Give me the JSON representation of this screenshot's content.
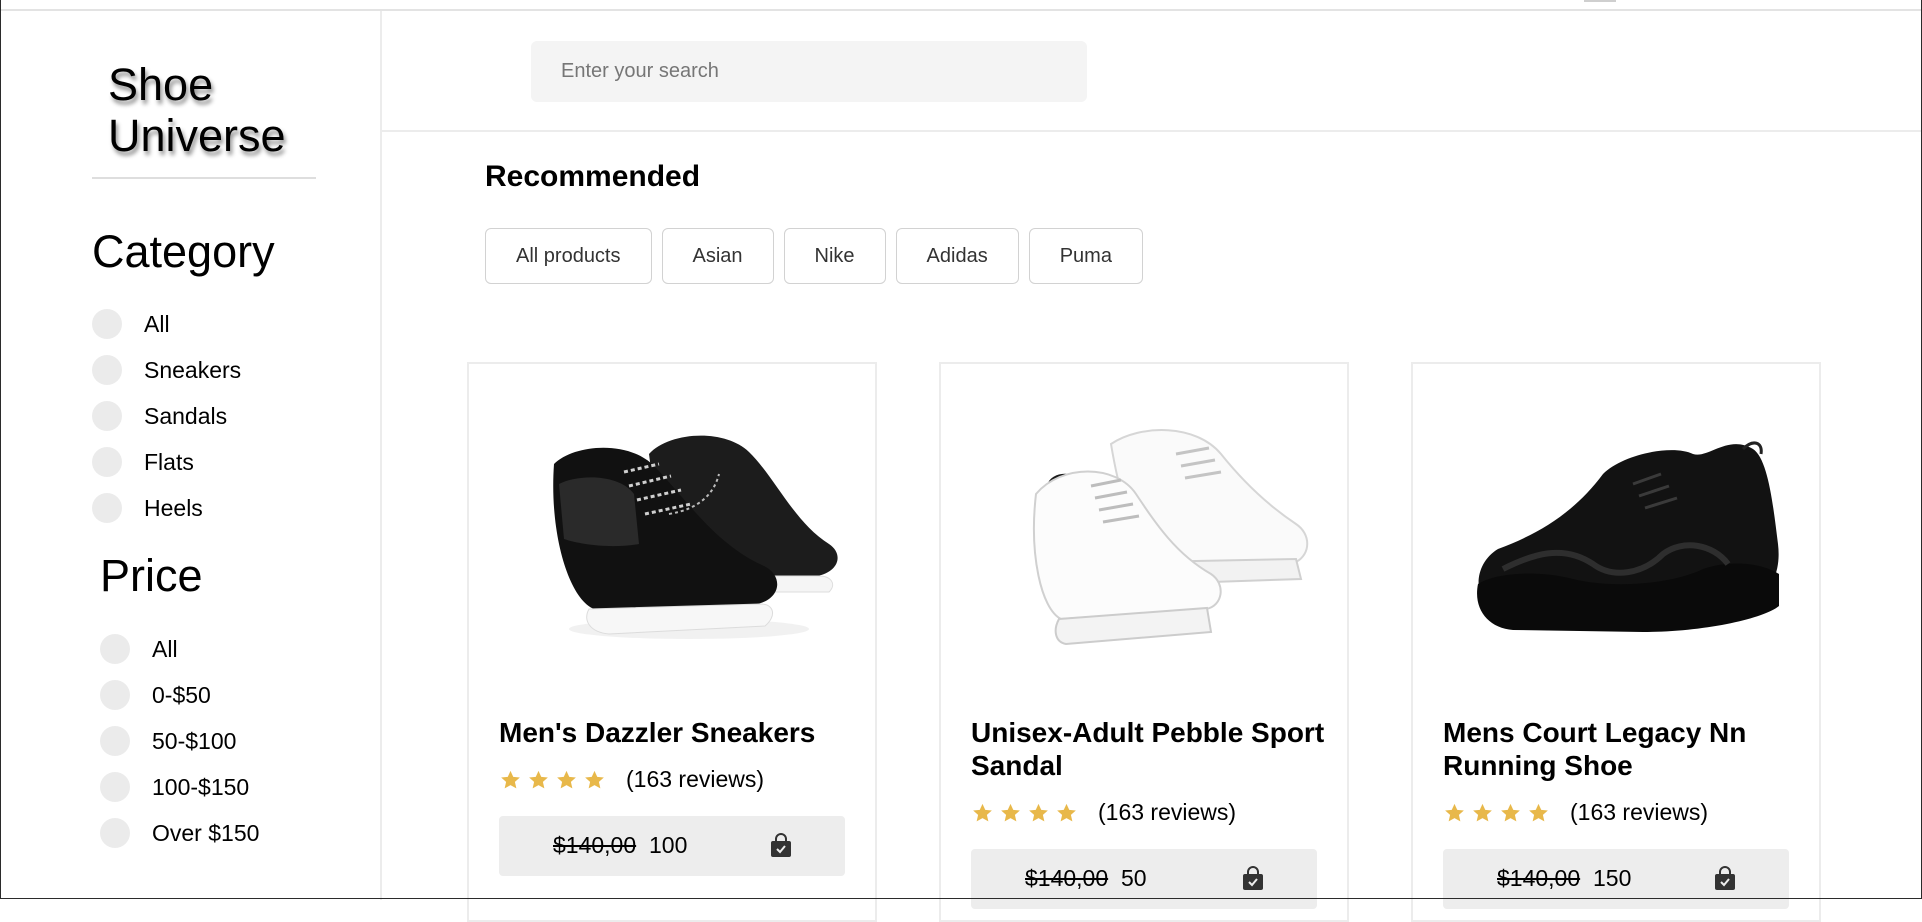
{
  "sidebar": {
    "logo": "Shoe Universe",
    "category": {
      "title": "Category",
      "options": [
        "All",
        "Sneakers",
        "Sandals",
        "Flats",
        "Heels"
      ]
    },
    "price": {
      "title": "Price",
      "options": [
        "All",
        "0-$50",
        "50-$100",
        "100-$150",
        "Over $150"
      ]
    }
  },
  "header": {
    "search_placeholder": "Enter your search"
  },
  "recommended": {
    "title": "Recommended",
    "filters": [
      "All products",
      "Asian",
      "Nike",
      "Adidas",
      "Puma"
    ]
  },
  "products": [
    {
      "title": "Men's Dazzler Sneakers",
      "rating": 4,
      "reviews": "(163 reviews)",
      "old_price": "$140,00",
      "new_price": "100",
      "image_icon": "black-sneaker-image"
    },
    {
      "title": "Unisex-Adult Pebble Sport Sandal",
      "rating": 4,
      "reviews": "(163 reviews)",
      "old_price": "$140,00",
      "new_price": "50",
      "image_icon": "white-platform-sneaker-image"
    },
    {
      "title": "Mens Court Legacy Nn Running Shoe",
      "rating": 4,
      "reviews": "(163 reviews)",
      "old_price": "$140,00",
      "new_price": "150",
      "image_icon": "black-chunky-shoe-image"
    }
  ],
  "colors": {
    "star": "#e8b84a",
    "radio": "#ebebeb",
    "price_bar": "#ededed",
    "search_bg": "#f4f4f4"
  }
}
